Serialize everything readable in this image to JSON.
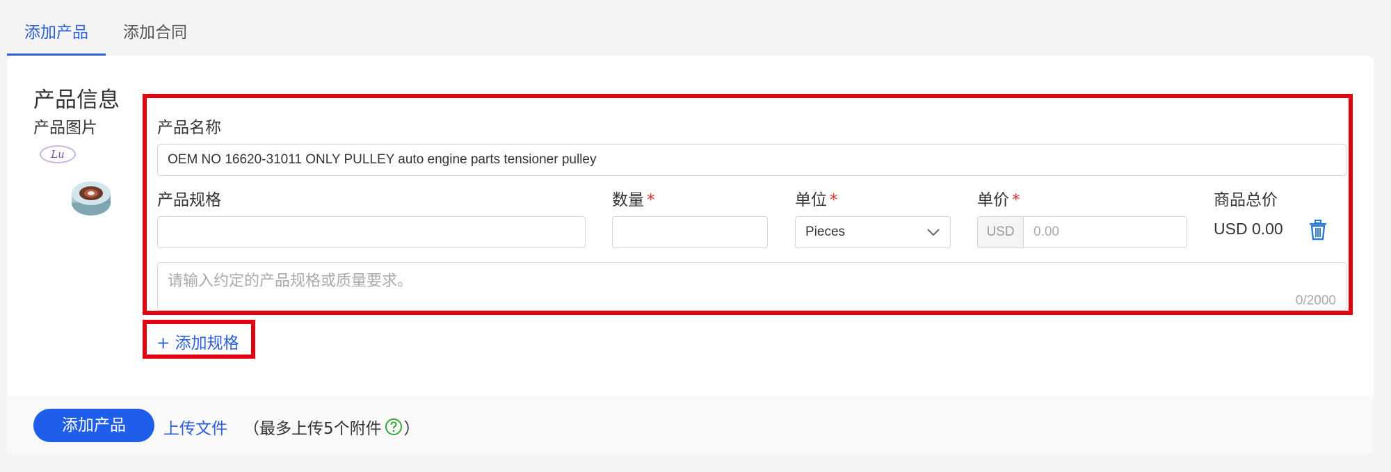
{
  "tabs": [
    {
      "label": "添加产品",
      "active": true
    },
    {
      "label": "添加合同",
      "active": false
    }
  ],
  "section": {
    "title": "产品信息",
    "image_label": "产品图片",
    "logo_text": "Lu"
  },
  "product": {
    "name_label": "产品名称",
    "name_value": "OEM NO 16620-31011 ONLY PULLEY auto engine parts tensioner pulley",
    "spec_label": "产品规格",
    "spec_value": "",
    "qty_label": "数量",
    "unit_label": "单位",
    "unit_value": "Pieces",
    "price_label": "单价",
    "price_currency": "USD",
    "price_placeholder": "0.00",
    "total_label": "商品总价",
    "total_value": "USD 0.00",
    "required_mark": "*",
    "spec_desc_placeholder": "请输入约定的产品规格或质量要求。",
    "spec_desc_counter": "0/2000"
  },
  "actions": {
    "add_spec": "+ 添加规格",
    "add_product": "添加产品",
    "upload_file": "上传文件",
    "upload_note_prefix": "（最多上传5个附件",
    "upload_note_suffix": "）"
  },
  "colors": {
    "accent": "#2b5fd6",
    "primary_button": "#1f5eea",
    "highlight_box": "#e0000f",
    "required": "#d9342b",
    "help_icon": "#3aa33a"
  },
  "icons": {
    "unit_dropdown": "chevron-down-icon",
    "delete": "trash-icon",
    "help": "question-circle-icon"
  }
}
